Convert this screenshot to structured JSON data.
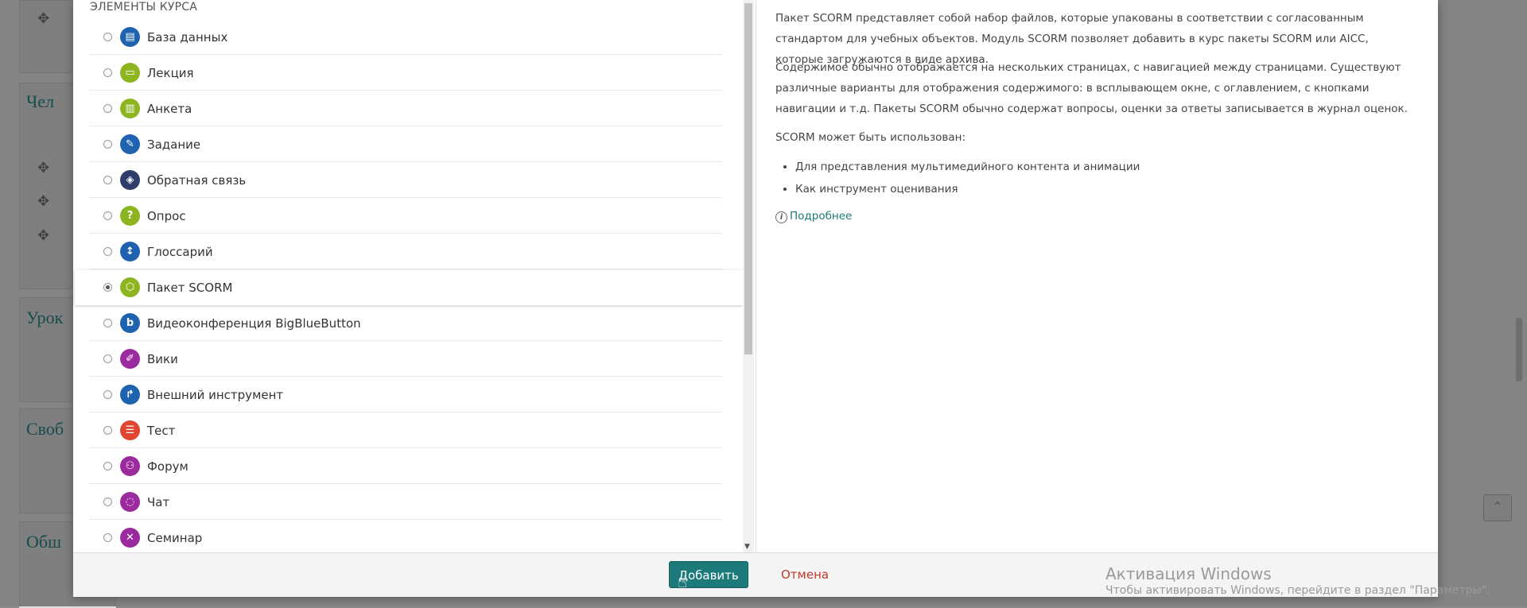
{
  "background": {
    "section_headings": [
      "Чел",
      "Урок",
      "Своб",
      "Обш"
    ]
  },
  "modal": {
    "list_title": "ЭЛЕМЕНТЫ КУРСА",
    "options": [
      {
        "label": "База данных",
        "icon": "database-icon",
        "color": "#1e62b0",
        "glyph": "▤"
      },
      {
        "label": "Лекция",
        "icon": "lesson-icon",
        "color": "#8cb51f",
        "glyph": "▭"
      },
      {
        "label": "Анкета",
        "icon": "survey-icon",
        "color": "#8cb51f",
        "glyph": "▥"
      },
      {
        "label": "Задание",
        "icon": "assignment-icon",
        "color": "#1e62b0",
        "glyph": "✎"
      },
      {
        "label": "Обратная связь",
        "icon": "feedback-icon",
        "color": "#2f3d6b",
        "glyph": "◈"
      },
      {
        "label": "Опрос",
        "icon": "choice-icon",
        "color": "#8cb51f",
        "glyph": "?"
      },
      {
        "label": "Глоссарий",
        "icon": "glossary-icon",
        "color": "#1e62b0",
        "glyph": "↕"
      },
      {
        "label": "Пакет SCORM",
        "icon": "scorm-package-icon",
        "color": "#8cb51f",
        "glyph": "⬡",
        "selected": true
      },
      {
        "label": "Видеоконференция BigBlueButton",
        "icon": "bigbluebutton-icon",
        "color": "#1e62b0",
        "glyph": "b"
      },
      {
        "label": "Вики",
        "icon": "wiki-icon",
        "color": "#9b2a9e",
        "glyph": "✐"
      },
      {
        "label": "Внешний инструмент",
        "icon": "external-tool-icon",
        "color": "#1e62b0",
        "glyph": "↱"
      },
      {
        "label": "Тест",
        "icon": "quiz-icon",
        "color": "#e0452f",
        "glyph": "☰"
      },
      {
        "label": "Форум",
        "icon": "forum-icon",
        "color": "#9b2a9e",
        "glyph": "⚇"
      },
      {
        "label": "Чат",
        "icon": "chat-icon",
        "color": "#9b2a9e",
        "glyph": "◌"
      },
      {
        "label": "Семинар",
        "icon": "workshop-icon",
        "color": "#9b2a9e",
        "glyph": "✕"
      }
    ],
    "description": {
      "p1": "Пакет SCORM представляет собой набор файлов, которые упакованы в соответствии с согласованным стандартом для учебных объектов. Модуль SCORM позволяет добавить в курс пакеты SCORM или AICC, которые загружаются в виде архива.",
      "p2": "Содержимое обычно отображается на нескольких страницах, с навигацией между страницами. Существуют различные варианты для отображения содержимого: в всплывающем окне, с оглавлением, с кнопками навигации и т.д. Пакеты SCORM обычно содержат вопросы, оценки за ответы записывается в журнал оценок.",
      "p3": "SCORM может быть использован:",
      "bullets": [
        "Для представления мультимедийного контента и анимации",
        "Как инструмент оценивания"
      ],
      "more_link": "Подробнее"
    },
    "footer": {
      "add_button": "Добавить",
      "cancel_button": "Отмена"
    }
  },
  "watermark": {
    "title": "Активация Windows",
    "subtitle": "Чтобы активировать Windows, перейдите в раздел \"Параметры\"."
  }
}
